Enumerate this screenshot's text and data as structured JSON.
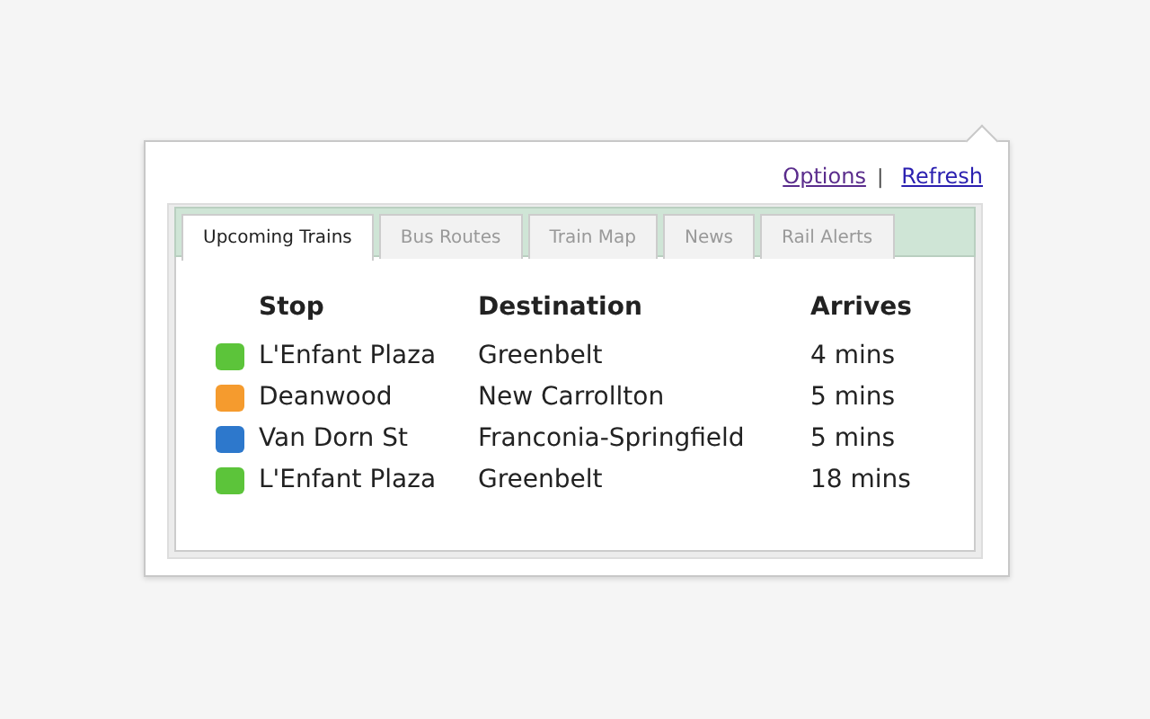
{
  "links": [
    {
      "label": "Options"
    },
    {
      "label": "Refresh"
    }
  ],
  "separator": "|",
  "tabs": [
    {
      "label": "Upcoming Trains",
      "selected": true
    },
    {
      "label": "Bus Routes",
      "selected": false
    },
    {
      "label": "Train Map",
      "selected": false
    },
    {
      "label": "News",
      "selected": false
    },
    {
      "label": "Rail Alerts",
      "selected": false
    }
  ],
  "table": {
    "columns": [
      "Stop",
      "Destination",
      "Arrives"
    ],
    "rows": [
      {
        "color": "#5cc43a",
        "stop": "L'Enfant Plaza",
        "destination": "Greenbelt",
        "arrives": "4 mins"
      },
      {
        "color": "#f59b2e",
        "stop": "Deanwood",
        "destination": "New Carrollton",
        "arrives": "5 mins"
      },
      {
        "color": "#2d78cc",
        "stop": "Van Dorn St",
        "destination": "Franconia-Springfield",
        "arrives": "5 mins"
      },
      {
        "color": "#5cc43a",
        "stop": "L'Enfant Plaza",
        "destination": "Greenbelt",
        "arrives": "18 mins"
      }
    ]
  }
}
